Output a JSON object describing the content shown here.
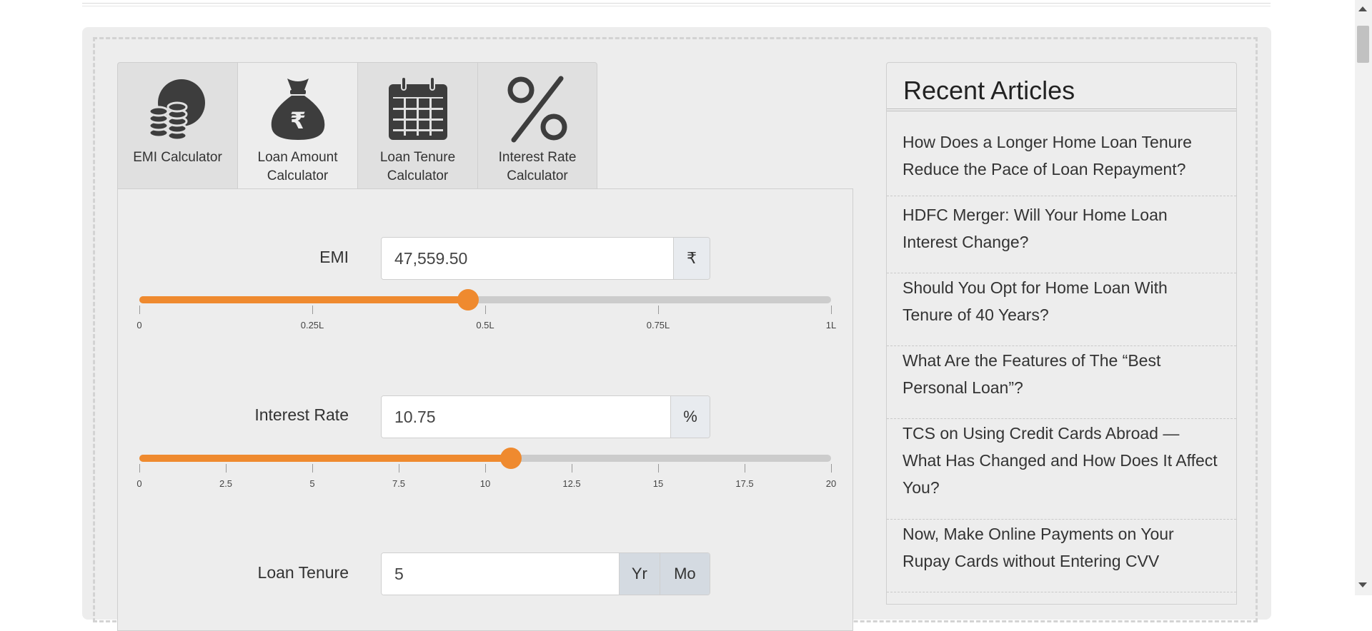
{
  "tabs": [
    {
      "label": "EMI Calculator",
      "icon": "coins-clock-icon",
      "active": false
    },
    {
      "label": "Loan Amount Calculator",
      "icon": "money-bag-rupee-icon",
      "active": true
    },
    {
      "label": "Loan Tenure Calculator",
      "icon": "calendar-icon",
      "active": false
    },
    {
      "label": "Interest Rate Calculator",
      "icon": "percent-icon",
      "active": false
    }
  ],
  "emi": {
    "label": "EMI",
    "value": "47,559.50",
    "addon": "₹",
    "slider_fraction": 0.475,
    "ticks": [
      "0",
      "0.25L",
      "0.5L",
      "0.75L",
      "1L"
    ]
  },
  "interest": {
    "label": "Interest Rate",
    "value": "10.75",
    "addon": "%",
    "slider_fraction": 0.5375,
    "ticks": [
      "0",
      "2.5",
      "5",
      "7.5",
      "10",
      "12.5",
      "15",
      "17.5",
      "20"
    ]
  },
  "tenure": {
    "label": "Loan Tenure",
    "value": "5",
    "unit_year": "Yr",
    "unit_month": "Mo"
  },
  "sidebar": {
    "title": "Recent Articles",
    "articles": [
      "How Does a Longer Home Loan Tenure Reduce the Pace of Loan Repayment?",
      "HDFC Merger: Will Your Home Loan Interest Change?",
      "Should You Opt for Home Loan With Tenure of 40 Years?",
      "What Are the Features of The “Best Personal Loan”?",
      "TCS on Using Credit Cards Abroad — What Has Changed and How Does It Affect You?",
      "Now, Make Online Payments on Your Rupay Cards without Entering CVV"
    ]
  },
  "colors": {
    "accent": "#ef8a2f",
    "track": "#cccccc",
    "icon": "#3d3d3d"
  }
}
